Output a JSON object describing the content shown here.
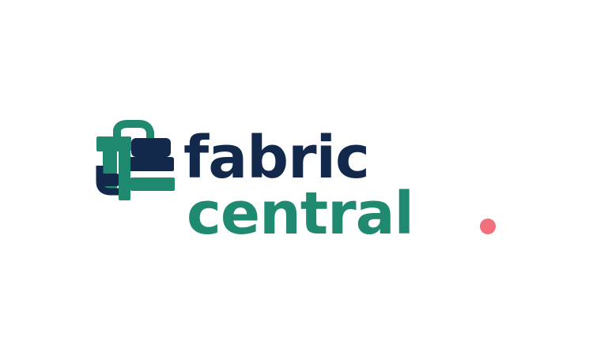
{
  "brand": {
    "word_top": "fabric",
    "word_bottom_prefix": "ce",
    "word_bottom_suffix": "ntral",
    "wordmark": "fabric central."
  },
  "colors": {
    "background": "#ffffff",
    "navy": "#13294b",
    "green": "#1f8a70",
    "dot": "#f0707b"
  },
  "icons": {
    "mark": "woven-fabric-logo-icon",
    "dot": "period-dot"
  }
}
